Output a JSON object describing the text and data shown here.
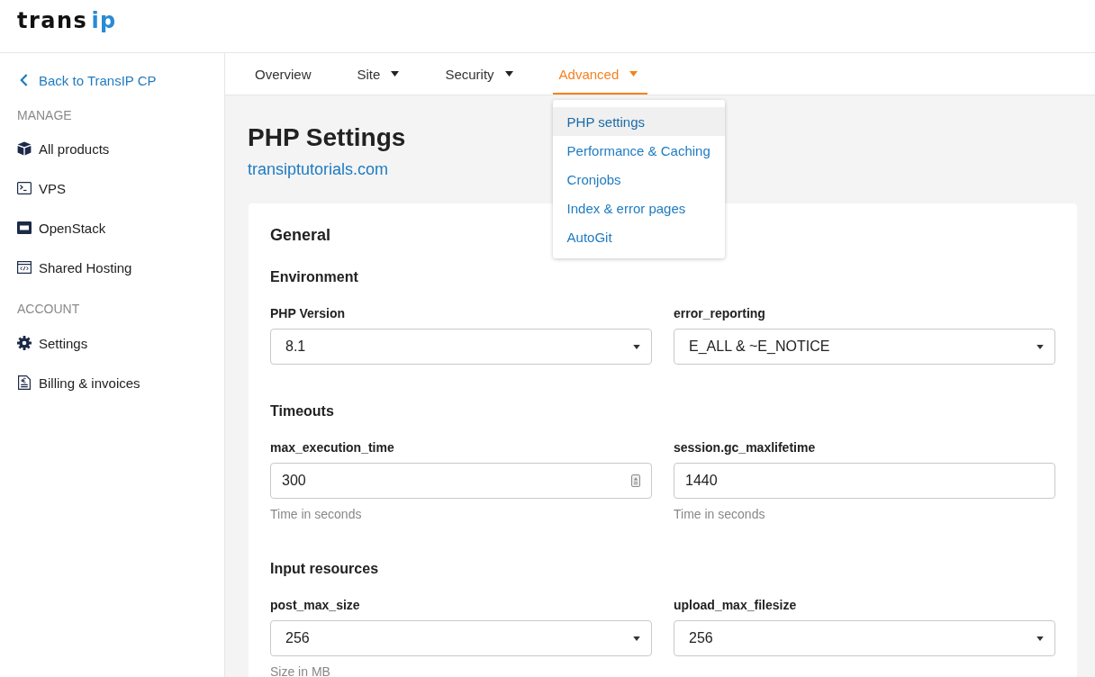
{
  "header": {
    "logo": [
      {
        "text": "trans",
        "kind": "plain"
      },
      {
        "text": "ip",
        "kind": "accent"
      }
    ]
  },
  "sidebar": {
    "back_link": "Back to TransIP CP",
    "sections": [
      {
        "heading": "MANAGE",
        "items": [
          {
            "label": "All products"
          },
          {
            "label": "VPS"
          },
          {
            "label": "OpenStack"
          },
          {
            "label": "Shared Hosting"
          }
        ]
      },
      {
        "heading": "ACCOUNT",
        "items": [
          {
            "label": "Settings"
          },
          {
            "label": "Billing & invoices"
          }
        ]
      }
    ]
  },
  "tabs": [
    {
      "label": "Overview",
      "dropdown": false,
      "selected": false
    },
    {
      "label": "Site",
      "dropdown": true,
      "selected": false
    },
    {
      "label": "Security",
      "dropdown": true,
      "selected": false
    },
    {
      "label": "Advanced",
      "dropdown": true,
      "selected": true,
      "menu": [
        {
          "label": "PHP settings",
          "selected": true
        },
        {
          "label": "Performance & Caching",
          "selected": false
        },
        {
          "label": "Cronjobs",
          "selected": false
        },
        {
          "label": "Index & error pages",
          "selected": false
        },
        {
          "label": "AutoGit",
          "selected": false
        }
      ]
    }
  ],
  "page": {
    "title": "PHP Settings",
    "subtitle": "transiptutorials.com"
  },
  "card": {
    "title": "General",
    "sections": [
      {
        "title": "Environment",
        "fields": [
          {
            "label": "PHP Version",
            "kind": "select",
            "value": "8.1"
          },
          {
            "label": "error_reporting",
            "kind": "select",
            "value": "E_ALL & ~E_NOTICE"
          }
        ]
      },
      {
        "title": "Timeouts",
        "fields": [
          {
            "label": "max_execution_time",
            "kind": "number",
            "value": "300",
            "help": "Time in seconds"
          },
          {
            "label": "session.gc_maxlifetime",
            "kind": "text",
            "value": "1440",
            "help": "Time in seconds"
          }
        ]
      },
      {
        "title": "Input resources",
        "fields": [
          {
            "label": "post_max_size",
            "kind": "select",
            "value": "256",
            "help": "Size in MB"
          },
          {
            "label": "upload_max_filesize",
            "kind": "select",
            "value": "256"
          }
        ]
      }
    ]
  }
}
